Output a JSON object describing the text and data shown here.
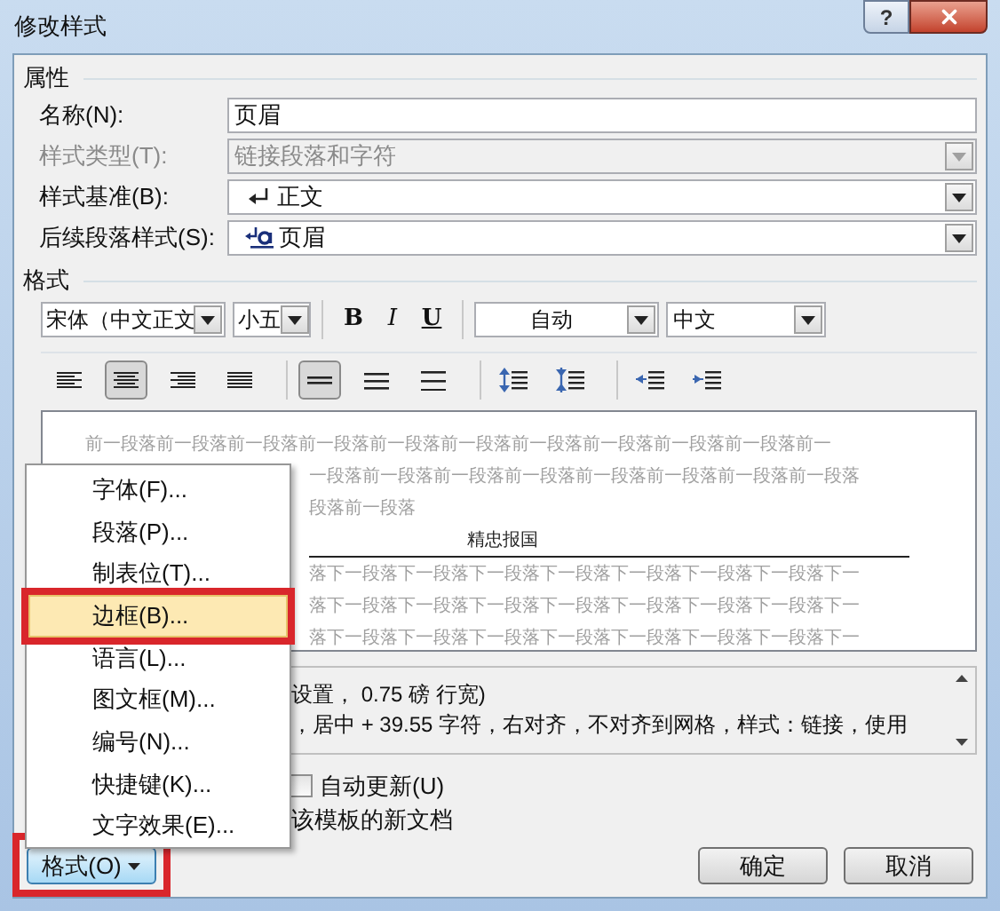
{
  "window": {
    "title": "修改样式",
    "help_button": "?"
  },
  "properties": {
    "heading": "属性",
    "rows": [
      {
        "label": "名称(N):",
        "kind": "text",
        "value": "页眉",
        "disabled": false
      },
      {
        "label": "样式类型(T):",
        "kind": "plain",
        "value": "链接段落和字符",
        "disabled": true
      },
      {
        "label": "样式基准(B):",
        "kind": "paragraph",
        "value": "正文",
        "disabled": false
      },
      {
        "label": "后续段落样式(S):",
        "kind": "linked",
        "value": "页眉",
        "disabled": false
      }
    ]
  },
  "format": {
    "heading": "格式",
    "font": "宋体（中文正文",
    "size": "小五",
    "style_buttons": [
      "B",
      "I",
      "U"
    ],
    "font_color_setting": "自动",
    "language": "中文",
    "alignment_buttons": [
      {
        "kind": "left",
        "selected": false
      },
      {
        "kind": "center",
        "selected": true
      },
      {
        "kind": "right",
        "selected": false
      },
      {
        "kind": "justify",
        "selected": false
      }
    ],
    "spacing_buttons": [
      {
        "kind": "single",
        "selected": true
      },
      {
        "kind": "one-half",
        "selected": false
      },
      {
        "kind": "double",
        "selected": false
      }
    ],
    "paragraph_buttons": [
      {
        "kind": "space-before"
      },
      {
        "kind": "space-after"
      },
      {
        "kind": "indent-less"
      },
      {
        "kind": "indent-more"
      }
    ]
  },
  "preview": {
    "before_lines": [
      "前一段落前一段落前一段落前一段落前一段落前一段落前一段落前一段落前一段落前一段落前一",
      "一段落前一段落前一段落前一段落前一段落前一段落前一段落前一段落",
      "段落前一段落"
    ],
    "sample": "精忠报国",
    "after_lines": [
      "落下一段落下一段落下一段落下一段落下一段落下一段落下一段落下一",
      "落下一段落下一段落下一段落下一段落下一段落下一段落下一段落下一",
      "落下一段落下一段落下一段落下一段落下一段落下一段落下一段落下一"
    ]
  },
  "description": [
    "设置， 0.75 磅 行宽)",
    "，居中 +  39.55 字符，右对齐，不对齐到网格，样式：链接，使用"
  ],
  "options": {
    "auto_update": {
      "label": "自动更新(U)",
      "checked": false
    },
    "template_option": "该模板的新文档"
  },
  "format_menu": {
    "button": "格式(O)",
    "items": [
      {
        "label": "字体(F)...",
        "selected": false
      },
      {
        "label": "段落(P)...",
        "selected": false
      },
      {
        "label": "制表位(T)...",
        "selected": false
      },
      {
        "label": "边框(B)...",
        "selected": true
      },
      {
        "label": "语言(L)...",
        "selected": false
      },
      {
        "label": "图文框(M)...",
        "selected": false
      },
      {
        "label": "编号(N)...",
        "selected": false
      },
      {
        "label": "快捷键(K)...",
        "selected": false
      },
      {
        "label": "文字效果(E)...",
        "selected": false
      }
    ]
  },
  "buttons": [
    "确定",
    "取消"
  ]
}
